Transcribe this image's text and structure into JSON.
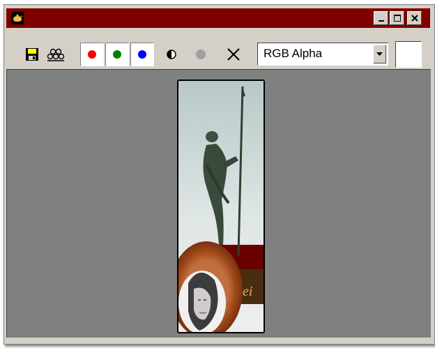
{
  "window": {
    "title": "",
    "controls": [
      {
        "name": "minimize-button",
        "icon": "minimize-icon"
      },
      {
        "name": "maximize-button",
        "icon": "maximize-icon"
      },
      {
        "name": "close-button",
        "icon": "close-icon"
      }
    ]
  },
  "toolbar": {
    "tools": [
      {
        "name": "save-image-button",
        "icon": "floppy-disk-icon"
      },
      {
        "name": "clone-window-button",
        "icon": "clone-icon"
      }
    ],
    "channels": [
      {
        "name": "red-channel-toggle",
        "icon": "red-dot-icon",
        "color": "#ff0000"
      },
      {
        "name": "green-channel-toggle",
        "icon": "green-dot-icon",
        "color": "#008000"
      },
      {
        "name": "blue-channel-toggle",
        "icon": "blue-dot-icon",
        "color": "#0000ff"
      }
    ],
    "extra_tools": [
      {
        "name": "mono-display-button",
        "icon": "half-circle-icon"
      },
      {
        "name": "alpha-display-button",
        "icon": "gray-dot-icon"
      },
      {
        "name": "clear-button",
        "icon": "x-icon"
      }
    ],
    "display_select": {
      "value": "RGB Alpha"
    },
    "swatch_color": "#ffffff"
  },
  "colors": {
    "titlebar": "#800000",
    "chrome": "#d4d0c8",
    "canvas_bg": "#808080"
  }
}
